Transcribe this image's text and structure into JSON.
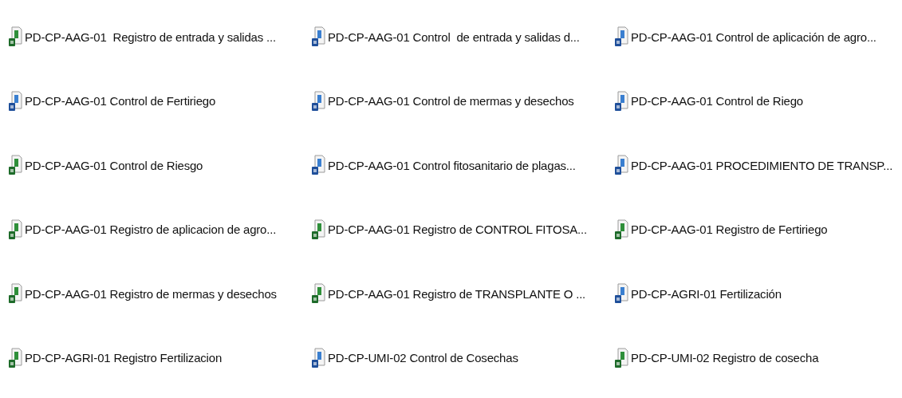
{
  "files": [
    {
      "name": "PD-CP-AAG-01  Registro de entrada y salidas ...",
      "kind": "spreadsheet"
    },
    {
      "name": "PD-CP-AAG-01 Control  de entrada y salidas d...",
      "kind": "document"
    },
    {
      "name": "PD-CP-AAG-01 Control de aplicación de agro...",
      "kind": "document"
    },
    {
      "name": "PD-CP-AAG-01 Control de Fertiriego",
      "kind": "document"
    },
    {
      "name": "PD-CP-AAG-01 Control de mermas y desechos",
      "kind": "document"
    },
    {
      "name": "PD-CP-AAG-01 Control de Riego",
      "kind": "document"
    },
    {
      "name": "PD-CP-AAG-01 Control de Riesgo",
      "kind": "spreadsheet"
    },
    {
      "name": "PD-CP-AAG-01 Control fitosanitario de plagas...",
      "kind": "document"
    },
    {
      "name": "PD-CP-AAG-01 PROCEDIMIENTO DE TRANSP...",
      "kind": "document"
    },
    {
      "name": "PD-CP-AAG-01 Registro de aplicacion de agro...",
      "kind": "spreadsheet"
    },
    {
      "name": "PD-CP-AAG-01 Registro de CONTROL FITOSA...",
      "kind": "spreadsheet"
    },
    {
      "name": "PD-CP-AAG-01 Registro de Fertiriego",
      "kind": "spreadsheet"
    },
    {
      "name": "PD-CP-AAG-01 Registro de mermas y desechos",
      "kind": "spreadsheet"
    },
    {
      "name": "PD-CP-AAG-01 Registro de TRANSPLANTE O ...",
      "kind": "spreadsheet"
    },
    {
      "name": "PD-CP-AGRI-01 Fertilización",
      "kind": "document"
    },
    {
      "name": "PD-CP-AGRI-01 Registro Fertilizacion",
      "kind": "spreadsheet"
    },
    {
      "name": "PD-CP-UMI-02 Control de Cosechas",
      "kind": "document"
    },
    {
      "name": "PD-CP-UMI-02 Registro de cosecha",
      "kind": "spreadsheet"
    }
  ]
}
